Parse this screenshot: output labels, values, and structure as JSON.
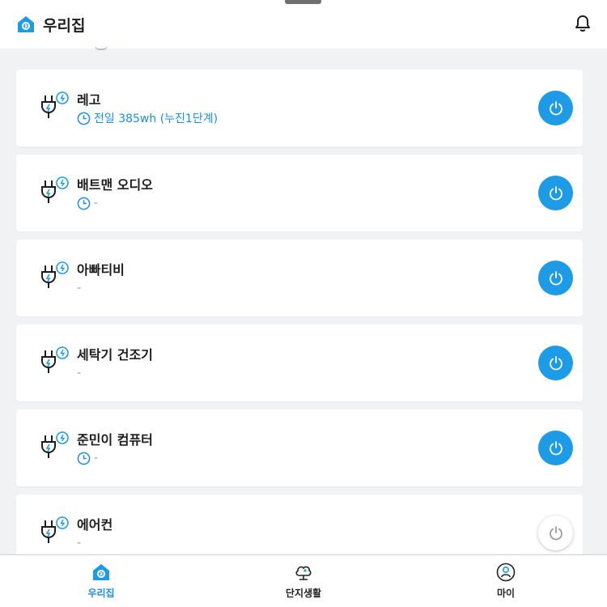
{
  "header": {
    "title": "우리집",
    "logo_icon": "home-logo-icon",
    "bell_icon": "bell-icon"
  },
  "colors": {
    "accent": "#1e9be6",
    "info_text": "#1a8ee6",
    "background": "#f1f2f4"
  },
  "devices": [
    {
      "name": "레고",
      "sub": "전일 385wh (누진1단계)",
      "show_clock": true,
      "power_on": true
    },
    {
      "name": "배트맨 오디오",
      "sub": "-",
      "show_clock": true,
      "power_on": true
    },
    {
      "name": "아빠티비",
      "sub": "-",
      "show_clock": false,
      "power_on": true
    },
    {
      "name": "세탁기 건조기",
      "sub": "-",
      "show_clock": false,
      "power_on": true
    },
    {
      "name": "준민이 컴퓨터",
      "sub": "-",
      "show_clock": true,
      "power_on": true
    },
    {
      "name": "에어컨",
      "sub": "-",
      "show_clock": false,
      "power_on": false
    }
  ],
  "tabs": [
    {
      "label": "우리집",
      "icon": "home-icon",
      "active": true
    },
    {
      "label": "단지생활",
      "icon": "complex-life-icon",
      "active": false
    },
    {
      "label": "마이",
      "icon": "my-profile-icon",
      "active": false
    }
  ]
}
